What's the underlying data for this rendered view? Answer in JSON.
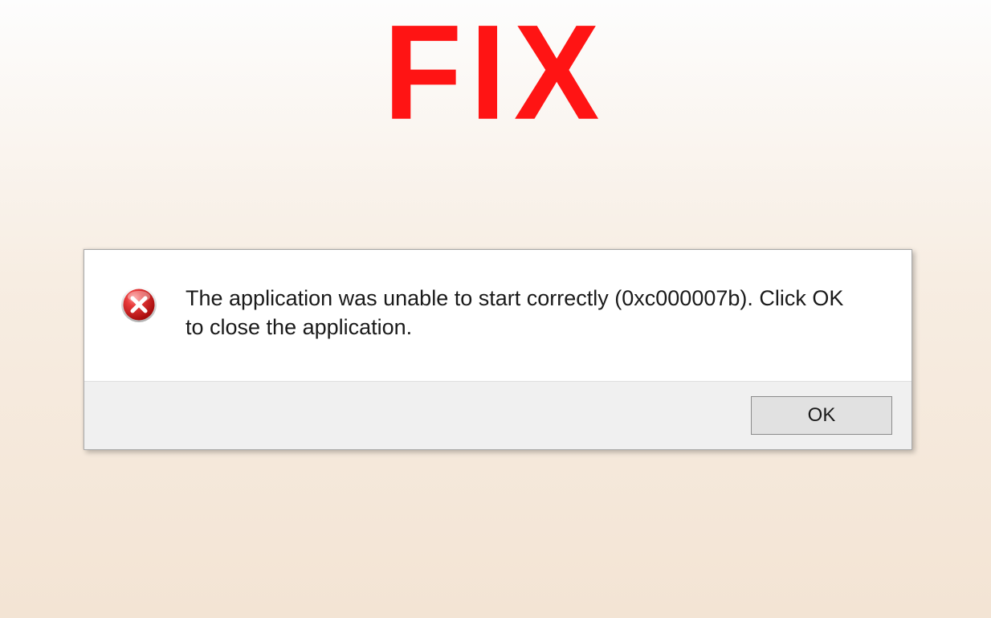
{
  "headline": "FIX",
  "dialog": {
    "message": "The application was unable to start correctly (0xc000007b). Click OK to close the application.",
    "button_label": "OK",
    "icon": "error-icon"
  }
}
